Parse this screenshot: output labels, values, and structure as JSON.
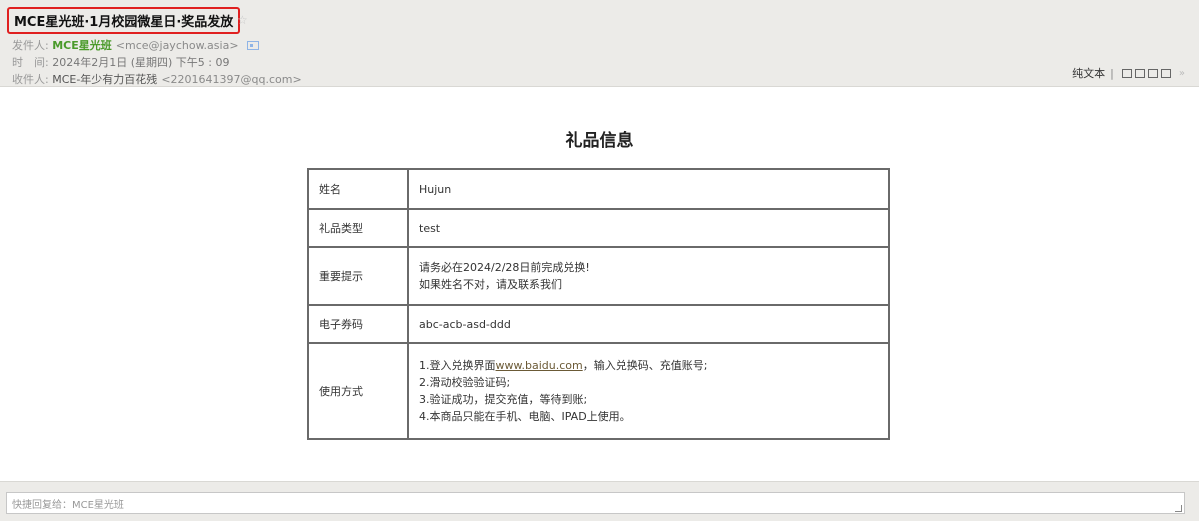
{
  "email": {
    "subject": "MCE星光班·1月校园微星日·奖品发放",
    "sender_label": "发件人:",
    "sender_name": "MCE星光班",
    "sender_email": "<mce@jaychow.asia>",
    "time_label": "时　间:",
    "time_value": "2024年2月1日 (星期四) 下午5 : 09",
    "recipient_label": "收件人:",
    "recipient_name": "MCE-年少有力百花残",
    "recipient_email": "<2201641397@qq.com>"
  },
  "toolbar": {
    "plain_text": "纯文本",
    "separator": "|",
    "icons": [
      "new-window-icon",
      "expand-icon",
      "download-icon",
      "print-icon"
    ],
    "more": "»"
  },
  "body": {
    "title": "礼品信息",
    "rows": [
      {
        "key": "姓名",
        "value": "Hujun"
      },
      {
        "key": "礼品类型",
        "value": "test"
      },
      {
        "key": "重要提示",
        "lines": [
          "请务必在2024/2/28日前完成兑换!",
          "如果姓名不对，请及联系我们"
        ]
      },
      {
        "key": "电子券码",
        "value": "abc-acb-asd-ddd"
      },
      {
        "key": "使用方式",
        "line1_prefix": "1.登入兑换界面",
        "line1_link": "www.baidu.com",
        "line1_suffix": "，输入兑换码、充值账号;",
        "line2": "2.滑动校验验证码;",
        "line3": "3.验证成功，提交充值，等待到账;",
        "line4": "4.本商品只能在手机、电脑、IPAD上使用。"
      }
    ]
  },
  "quick_reply": {
    "placeholder": "快捷回复给：MCE星光班"
  }
}
